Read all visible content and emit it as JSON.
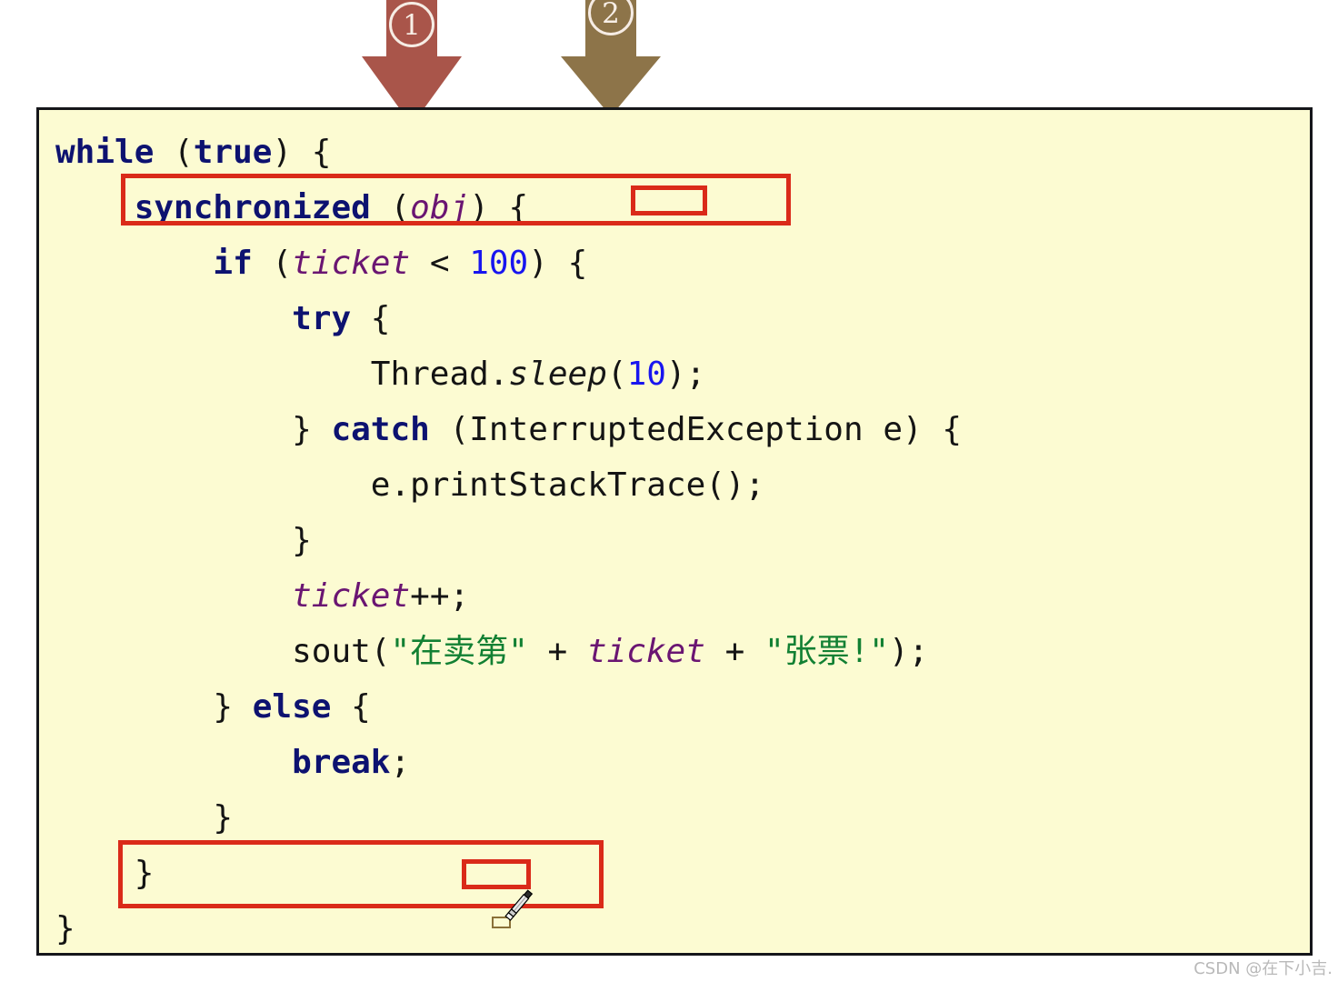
{
  "annotations": {
    "arrows": [
      {
        "id": "1",
        "label": "①",
        "badge": "1",
        "color": "#A9554A"
      },
      {
        "id": "2",
        "label": "②",
        "badge": "2",
        "color": "#8D7449"
      }
    ],
    "highlight_color": "#DA2A19",
    "boxes": [
      {
        "name": "synchronized-line-box",
        "target": "synchronized (obj) {"
      },
      {
        "name": "closing-brace-box",
        "target": "}"
      }
    ]
  },
  "code": {
    "language": "java",
    "background": "#FCFBD2",
    "border_color": "#15161A",
    "lines": [
      {
        "indent": 0,
        "tokens": [
          {
            "t": "while",
            "c": "kw"
          },
          {
            "t": " (",
            "c": "pln"
          },
          {
            "t": "true",
            "c": "kw"
          },
          {
            "t": ") {",
            "c": "pln"
          }
        ]
      },
      {
        "indent": 1,
        "tokens": [
          {
            "t": "synchronized",
            "c": "kw"
          },
          {
            "t": " (",
            "c": "pln"
          },
          {
            "t": "obj",
            "c": "var"
          },
          {
            "t": ") {",
            "c": "pln"
          }
        ]
      },
      {
        "indent": 2,
        "tokens": [
          {
            "t": "if",
            "c": "kw"
          },
          {
            "t": " (",
            "c": "pln"
          },
          {
            "t": "ticket",
            "c": "var"
          },
          {
            "t": " < ",
            "c": "pln"
          },
          {
            "t": "100",
            "c": "num"
          },
          {
            "t": ") {",
            "c": "pln"
          }
        ]
      },
      {
        "indent": 3,
        "tokens": [
          {
            "t": "try",
            "c": "kw"
          },
          {
            "t": " {",
            "c": "pln"
          }
        ]
      },
      {
        "indent": 4,
        "tokens": [
          {
            "t": "Thread.",
            "c": "pln"
          },
          {
            "t": "sleep",
            "c": "mth"
          },
          {
            "t": "(",
            "c": "pln"
          },
          {
            "t": "10",
            "c": "num"
          },
          {
            "t": ");",
            "c": "pln"
          }
        ]
      },
      {
        "indent": 3,
        "tokens": [
          {
            "t": "} ",
            "c": "pln"
          },
          {
            "t": "catch",
            "c": "kw"
          },
          {
            "t": " (InterruptedException e) {",
            "c": "pln"
          }
        ]
      },
      {
        "indent": 4,
        "tokens": [
          {
            "t": "e.printStackTrace();",
            "c": "pln"
          }
        ]
      },
      {
        "indent": 3,
        "tokens": [
          {
            "t": "}",
            "c": "pln"
          }
        ]
      },
      {
        "indent": 3,
        "tokens": [
          {
            "t": "ticket",
            "c": "var"
          },
          {
            "t": "++;",
            "c": "pln"
          }
        ]
      },
      {
        "indent": 3,
        "tokens": [
          {
            "t": "sout(",
            "c": "pln"
          },
          {
            "t": "\"在卖第\"",
            "c": "str"
          },
          {
            "t": " + ",
            "c": "pln"
          },
          {
            "t": "ticket",
            "c": "var"
          },
          {
            "t": " + ",
            "c": "pln"
          },
          {
            "t": "\"张票!\"",
            "c": "str"
          },
          {
            "t": ");",
            "c": "pln"
          }
        ]
      },
      {
        "indent": 2,
        "tokens": [
          {
            "t": "} ",
            "c": "pln"
          },
          {
            "t": "else",
            "c": "kw"
          },
          {
            "t": " {",
            "c": "pln"
          }
        ]
      },
      {
        "indent": 3,
        "tokens": [
          {
            "t": "break",
            "c": "kw"
          },
          {
            "t": ";",
            "c": "pln"
          }
        ]
      },
      {
        "indent": 2,
        "tokens": [
          {
            "t": "}",
            "c": "pln"
          }
        ]
      },
      {
        "indent": 1,
        "tokens": [
          {
            "t": "}",
            "c": "pln"
          }
        ]
      },
      {
        "indent": 0,
        "tokens": [
          {
            "t": "}",
            "c": "pln"
          }
        ]
      }
    ]
  },
  "cursor": {
    "type": "pencil-cursor",
    "marker_color": "#8A7038"
  },
  "watermark": {
    "text": "CSDN @在下小吉."
  }
}
